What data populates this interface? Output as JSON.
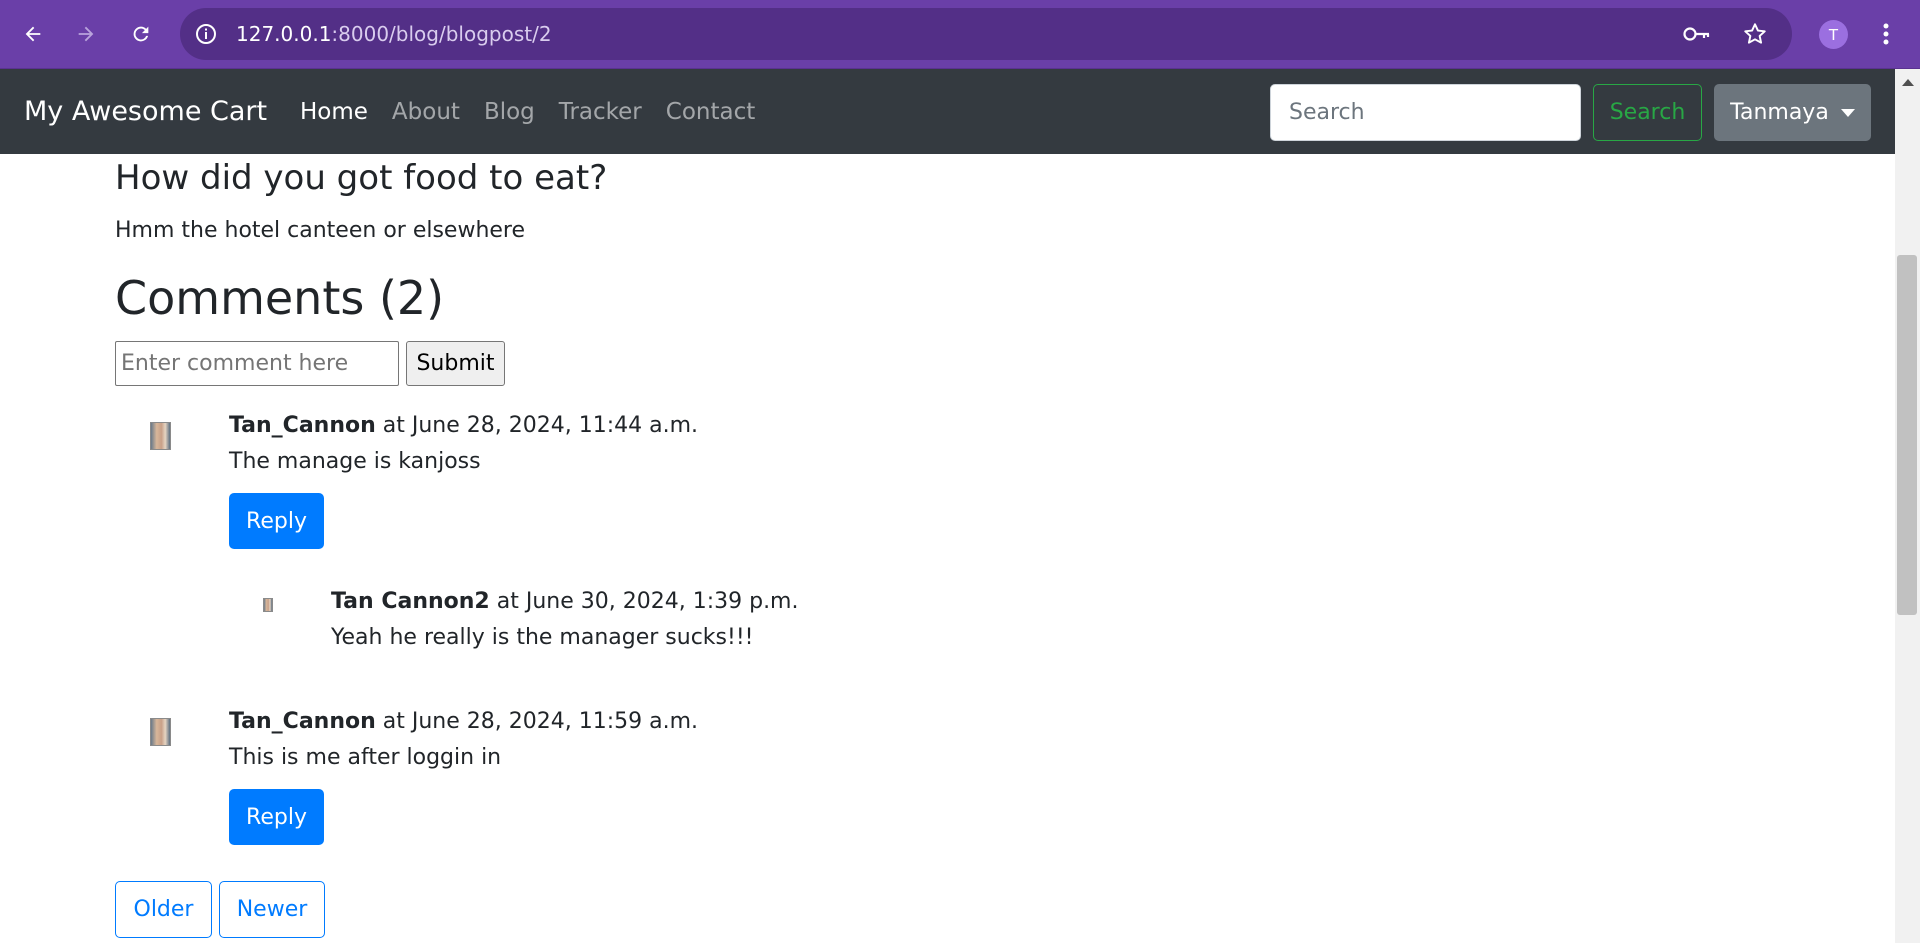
{
  "browser": {
    "url_host": "127.0.0.1",
    "url_path": ":8000/blog/blogpost/2",
    "profile_initial": "T"
  },
  "navbar": {
    "brand": "My Awesome Cart",
    "links": [
      {
        "label": "Home",
        "active": true
      },
      {
        "label": "About",
        "active": false
      },
      {
        "label": "Blog",
        "active": false
      },
      {
        "label": "Tracker",
        "active": false
      },
      {
        "label": "Contact",
        "active": false
      }
    ],
    "search_placeholder": "Search",
    "search_button": "Search",
    "user_menu": "Tanmaya"
  },
  "post": {
    "heading": "How did you got food to eat?",
    "body": "Hmm the hotel canteen or elsewhere"
  },
  "comments": {
    "heading": "Comments (2)",
    "input_placeholder": "Enter comment here",
    "submit_label": "Submit",
    "items": [
      {
        "author": "Tan_Cannon",
        "timestamp": " at June 28, 2024, 11:44 a.m.",
        "text": "The manage is kanjoss",
        "reply_label": "Reply",
        "replies": [
          {
            "author": "Tan Cannon2",
            "timestamp": " at June 30, 2024, 1:39 p.m.",
            "text": "Yeah he really is the manager sucks!!!"
          }
        ]
      },
      {
        "author": "Tan_Cannon",
        "timestamp": " at June 28, 2024, 11:59 a.m.",
        "text": "This is me after loggin in",
        "reply_label": "Reply",
        "replies": []
      }
    ]
  },
  "pagination": {
    "older": "Older",
    "newer": "Newer"
  },
  "colors": {
    "browser_chrome": "#6a3fa8",
    "navbar": "#343a40",
    "primary": "#007bff",
    "success": "#28a745",
    "secondary": "#6c757d"
  }
}
